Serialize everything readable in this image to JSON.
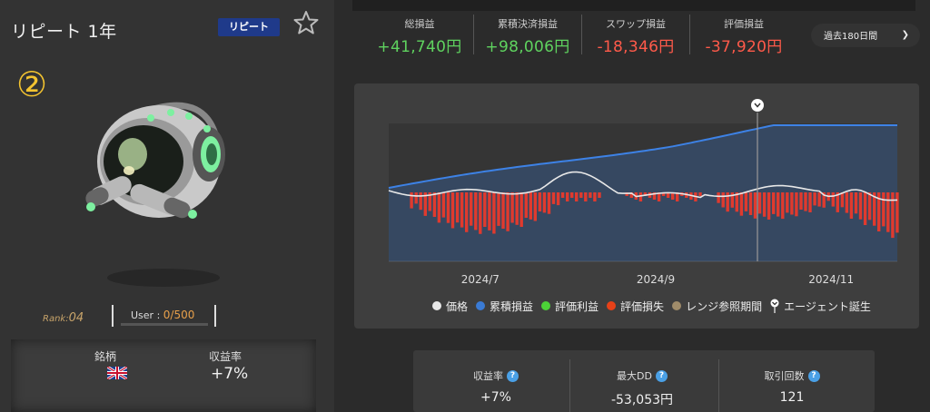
{
  "agent": {
    "title": "リピート 1年",
    "badge": "リピート",
    "number": "②",
    "rank_label": "Rank:",
    "rank_value": "04",
    "user_label": "User : ",
    "user_value": "0/500",
    "pair_label": "銘柄",
    "return_label": "収益率",
    "return_value": "+7%"
  },
  "stats": [
    {
      "label": "総損益",
      "value": "+41,740円",
      "color": "#5fd35f"
    },
    {
      "label": "累積決済損益",
      "value": "+98,006円",
      "color": "#5fd35f"
    },
    {
      "label": "スワップ損益",
      "value": "-18,346円",
      "color": "#ff5a4a"
    },
    {
      "label": "評価損益",
      "value": "-37,920円",
      "color": "#ff5a4a"
    }
  ],
  "period": {
    "label": "過去180日間",
    "arrow": "❯"
  },
  "legend": [
    {
      "label": "価格",
      "color": "#e8e8e8"
    },
    {
      "label": "累積損益",
      "color": "#3a7bd5"
    },
    {
      "label": "評価利益",
      "color": "#4cd137"
    },
    {
      "label": "評価損失",
      "color": "#e84118"
    },
    {
      "label": "レンジ参照期間",
      "color": "#a08c6a"
    },
    {
      "label": "エージェント誕生",
      "icon": "agent-birth-icon"
    }
  ],
  "summary": [
    {
      "label": "収益率",
      "value": "+7%"
    },
    {
      "label": "最大DD",
      "value": "-53,053円"
    },
    {
      "label": "取引回数",
      "value": "121"
    }
  ],
  "chart_data": {
    "type": "line",
    "x_ticks": [
      "2024/7",
      "2024/9",
      "2024/11"
    ],
    "series": [
      {
        "name": "累積損益",
        "color": "#3a7bd5"
      },
      {
        "name": "価格",
        "color": "#e8e8e8"
      },
      {
        "name": "評価損失",
        "color": "#e84118"
      }
    ],
    "agent_birth_marker": "2024/10",
    "grid": false
  }
}
